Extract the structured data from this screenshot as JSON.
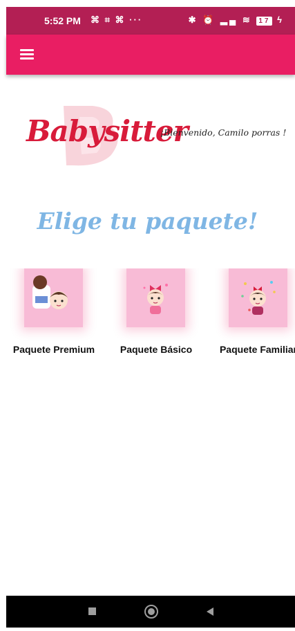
{
  "status_bar": {
    "time": "5:52 PM",
    "left_icons": "🔳 ⋮⋮ 🔳 ···",
    "battery": "17"
  },
  "app_bar": {
    "menu_icon": "hamburger-menu-icon"
  },
  "logo": {
    "text": "Babysitter"
  },
  "welcome": "¡Bienvenido, Camilo porras !",
  "heading": "Elige tu paquete!",
  "packages": [
    {
      "label": "Paquete Premium"
    },
    {
      "label": "Paquete Básico"
    },
    {
      "label": "Paquete Familiar"
    }
  ],
  "colors": {
    "status_bar": "#b31f54",
    "app_bar": "#e91e63",
    "heading": "#7fb6e4",
    "package_bg": "#f8bbd6",
    "logo": "#d81b3a"
  },
  "nav_bar": {
    "icons": [
      "recents-square-icon",
      "home-circle-icon",
      "back-triangle-icon"
    ]
  }
}
